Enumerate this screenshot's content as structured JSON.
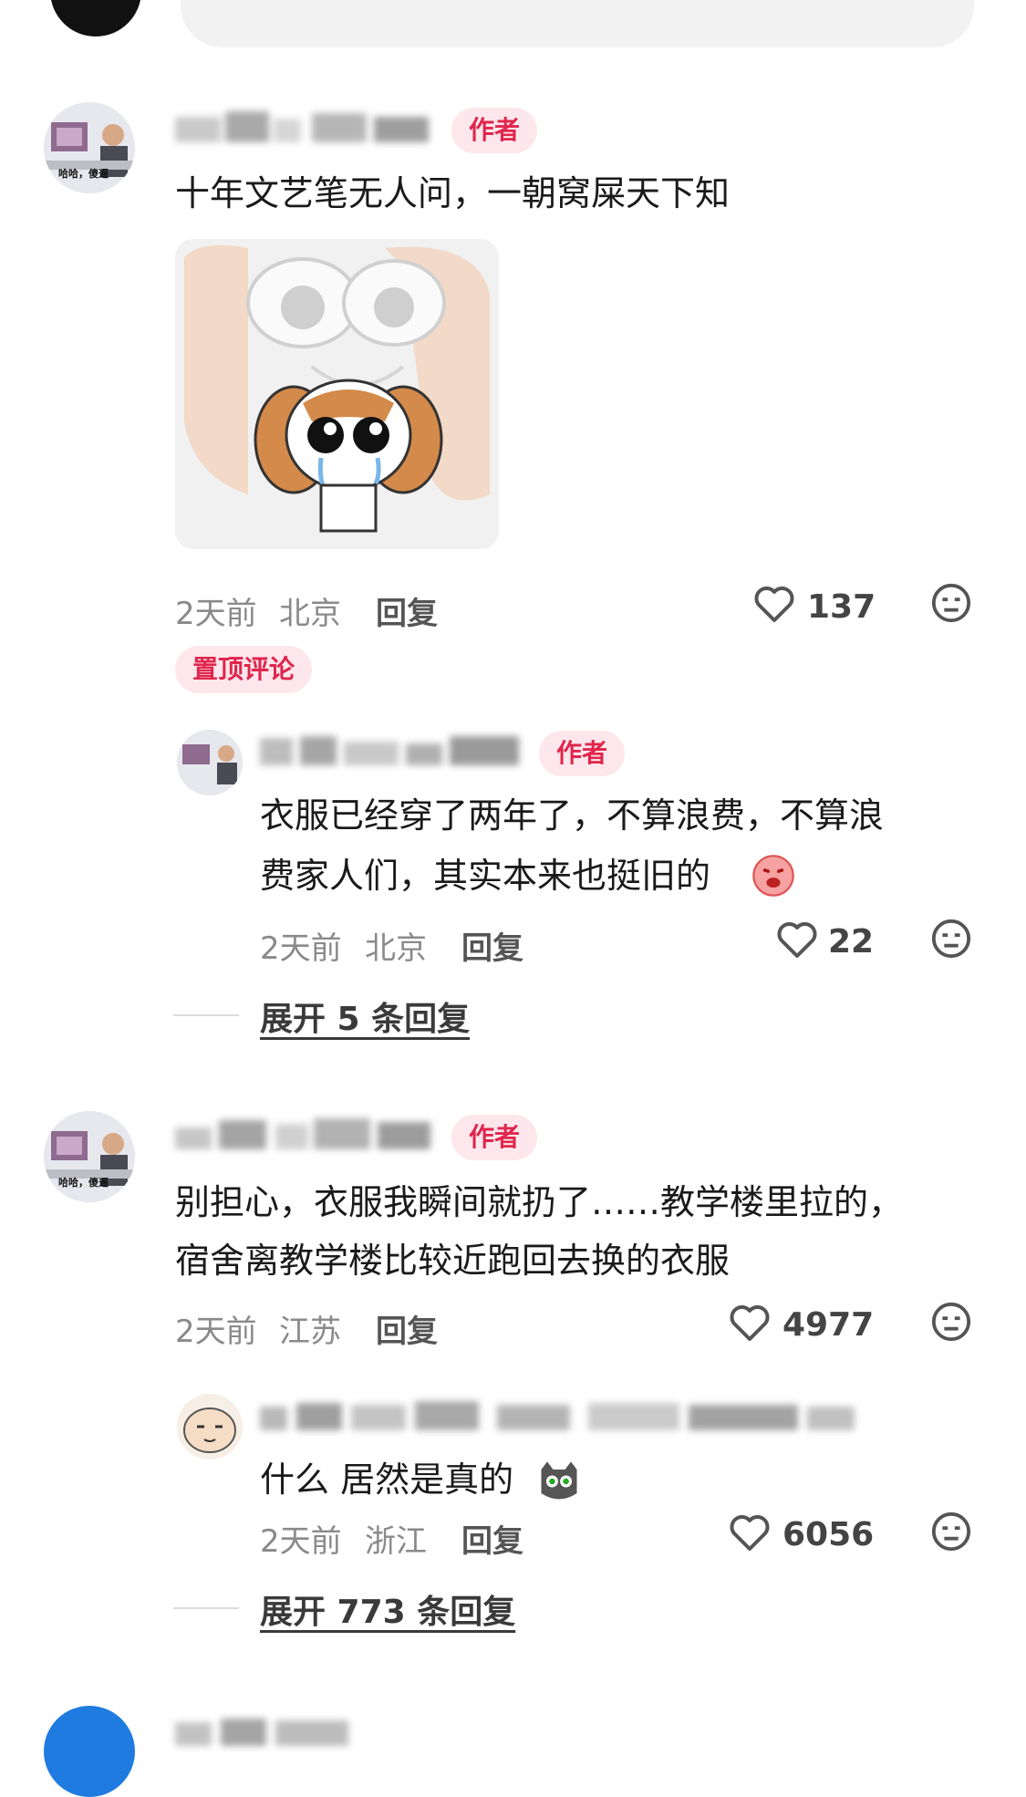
{
  "comments": [
    {
      "badge": "作者",
      "text": "十年文艺笔无人问，一朝窝屎天下知",
      "time": "2天前",
      "location": "北京",
      "reply": "回复",
      "likes": "137",
      "pinned": "置顶评论",
      "avatar_caption": "哈哈，傻逼",
      "replies": [
        {
          "badge": "作者",
          "text_line1": "衣服已经穿了两年了，不算浪费，不算浪",
          "text_line2": "费家人们，其实本来也挺旧的",
          "time": "2天前",
          "location": "北京",
          "reply": "回复",
          "likes": "22"
        }
      ],
      "expand": "展开 5 条回复"
    },
    {
      "badge": "作者",
      "text_line1": "别担心，衣服我瞬间就扔了……教学楼里拉的，",
      "text_line2": "宿舍离教学楼比较近跑回去换的衣服",
      "time": "2天前",
      "location": "江苏",
      "reply": "回复",
      "likes": "4977",
      "avatar_caption": "哈哈，傻逼",
      "replies": [
        {
          "text": "什么 居然是真的",
          "time": "2天前",
          "location": "浙江",
          "reply": "回复",
          "likes": "6056"
        }
      ],
      "expand": "展开 773 条回复"
    }
  ],
  "icons": {
    "like": "heart-outline-icon",
    "dislike": "neutral-face-icon"
  }
}
